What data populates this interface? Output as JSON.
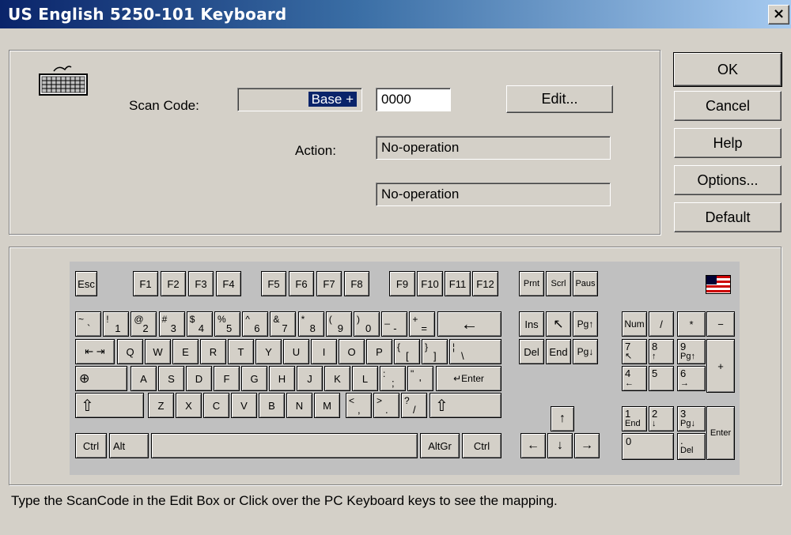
{
  "window": {
    "title": "US English 5250-101 Keyboard",
    "close_label": "×"
  },
  "scan": {
    "label": "Scan Code:",
    "prefix": "Base +",
    "value": "0000",
    "edit_label": "Edit..."
  },
  "action": {
    "label": "Action:",
    "value1": "No-operation",
    "value2": "No-operation"
  },
  "buttons": {
    "ok": "OK",
    "cancel": "Cancel",
    "help": "Help",
    "options": "Options...",
    "default": "Default"
  },
  "keys": {
    "esc": "Esc",
    "f1": "F1",
    "f2": "F2",
    "f3": "F3",
    "f4": "F4",
    "f5": "F5",
    "f6": "F6",
    "f7": "F7",
    "f8": "F8",
    "f9": "F9",
    "f10": "F10",
    "f11": "F11",
    "f12": "F12",
    "prnt": "Prnt",
    "scrl": "Scrl",
    "paus": "Paus",
    "num_row": [
      {
        "s": "~",
        "u": "`"
      },
      {
        "s": "!",
        "u": "1"
      },
      {
        "s": "@",
        "u": "2"
      },
      {
        "s": "#",
        "u": "3"
      },
      {
        "s": "$",
        "u": "4"
      },
      {
        "s": "%",
        "u": "5"
      },
      {
        "s": "^",
        "u": "6"
      },
      {
        "s": "&",
        "u": "7"
      },
      {
        "s": "*",
        "u": "8"
      },
      {
        "s": "(",
        "u": "9"
      },
      {
        "s": ")",
        "u": "0"
      },
      {
        "s": "_",
        "u": "-"
      },
      {
        "s": "+",
        "u": "="
      }
    ],
    "backspace": "←",
    "tab": "⇤ ⇥",
    "q_row": [
      "Q",
      "W",
      "E",
      "R",
      "T",
      "Y",
      "U",
      "I",
      "O",
      "P"
    ],
    "bracket_l": {
      "s": "{",
      "u": "["
    },
    "bracket_r": {
      "s": "}",
      "u": "]"
    },
    "backslash": {
      "s": "¦",
      "u": "\\"
    },
    "caps": "⊕",
    "a_row": [
      "A",
      "S",
      "D",
      "F",
      "G",
      "H",
      "J",
      "K",
      "L"
    ],
    "semicolon": {
      "s": ":",
      "u": ";"
    },
    "quote": {
      "s": "\"",
      "u": "'"
    },
    "enter": "↵Enter",
    "shift": "⇧",
    "z_row": [
      "Z",
      "X",
      "C",
      "V",
      "B",
      "N",
      "M"
    ],
    "comma": {
      "s": "<",
      "u": ","
    },
    "period": {
      "s": ">",
      "u": "."
    },
    "slash": {
      "s": "?",
      "u": "/"
    },
    "ctrl": "Ctrl",
    "alt": "Alt",
    "altgr": "AltGr",
    "ins": "Ins",
    "home": "↖",
    "pgup": "Pg↑",
    "del": "Del",
    "end": "End",
    "pgdn": "Pg↓",
    "up": "↑",
    "left": "←",
    "down": "↓",
    "right": "→",
    "num": "Num",
    "np_div": "/",
    "np_mul": "*",
    "np_sub": "−",
    "np7": {
      "d": "7",
      "s": "↖"
    },
    "np8": {
      "d": "8",
      "s": "↑"
    },
    "np9": {
      "d": "9",
      "s": "Pg↑"
    },
    "np_add": "+",
    "np4": {
      "d": "4",
      "s": "←"
    },
    "np5": {
      "d": "5",
      "s": ""
    },
    "np6": {
      "d": "6",
      "s": "→"
    },
    "np1": {
      "d": "1",
      "s": "End"
    },
    "np2": {
      "d": "2",
      "s": "↓"
    },
    "np3": {
      "d": "3",
      "s": "Pg↓"
    },
    "np_enter": "Enter",
    "np0": "0",
    "np_dot": {
      "d": ".",
      "s": "Del"
    }
  },
  "footer": "Type the ScanCode in the Edit Box or Click over the PC Keyboard keys to see the mapping."
}
